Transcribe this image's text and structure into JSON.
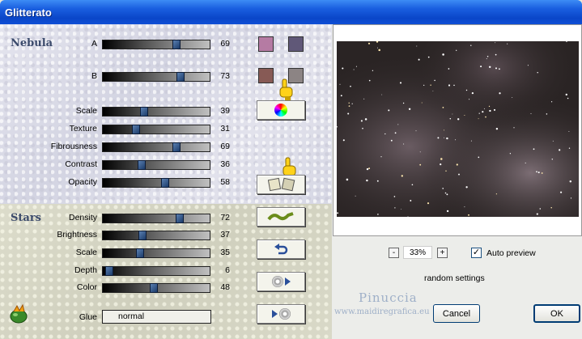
{
  "window": {
    "title": "Glitterato"
  },
  "nebula": {
    "section_label": "Nebula",
    "sliders": [
      {
        "label": "A",
        "value": "69",
        "fraction": 0.69
      },
      {
        "label": "B",
        "value": "73",
        "fraction": 0.73
      },
      {
        "label": "Scale",
        "value": "39",
        "fraction": 0.39
      },
      {
        "label": "Texture",
        "value": "31",
        "fraction": 0.31
      },
      {
        "label": "Fibrousness",
        "value": "69",
        "fraction": 0.69
      },
      {
        "label": "Contrast",
        "value": "36",
        "fraction": 0.36
      },
      {
        "label": "Opacity",
        "value": "58",
        "fraction": 0.58
      }
    ],
    "colors": {
      "a1": "#b57ba3",
      "a2": "#605878",
      "b1": "#875a55",
      "b2": "#8c8484"
    }
  },
  "stars": {
    "section_label": "Stars",
    "sliders": [
      {
        "label": "Density",
        "value": "72",
        "fraction": 0.72
      },
      {
        "label": "Brightness",
        "value": "37",
        "fraction": 0.37
      },
      {
        "label": "Scale",
        "value": "35",
        "fraction": 0.35
      },
      {
        "label": "Depth",
        "value": "6",
        "fraction": 0.06
      },
      {
        "label": "Color",
        "value": "48",
        "fraction": 0.48
      }
    ]
  },
  "glue": {
    "label": "Glue",
    "value": "normal"
  },
  "preview": {
    "zoom": "33%",
    "zoom_minus": "-",
    "zoom_plus": "+",
    "auto_preview_label": "Auto preview",
    "auto_preview_checked": "✓"
  },
  "random_label": "random settings",
  "watermark": {
    "name": "Pinuccia",
    "url": "www.maidiregrafica.eu"
  },
  "buttons": {
    "cancel": "Cancel",
    "ok": "OK"
  }
}
